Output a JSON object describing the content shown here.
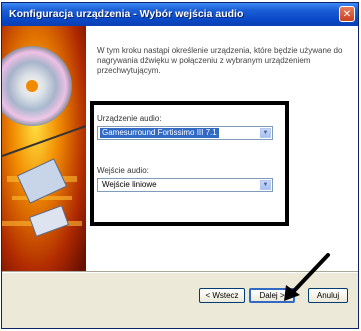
{
  "window": {
    "title": "Konfiguracja urządzenia - Wybór wejścia audio",
    "close_label": "✕"
  },
  "description": "W tym kroku nastąpi określenie urządzenia, które będzie używane do nagrywania dźwięku w połączeniu z wybranym urządzeniem przechwytującym.",
  "audio_device": {
    "label": "Urządzenie audio:",
    "value": "Gamesurround Fortissimo III 7.1"
  },
  "audio_input": {
    "label": "Wejście audio:",
    "value": "Wejście liniowe"
  },
  "buttons": {
    "back": "< Wstecz",
    "next": "Dalej >",
    "cancel": "Anuluj"
  },
  "icons": {
    "close": "close-icon",
    "dropdown": "chevron-down-icon",
    "pointer": "arrow-pointer-icon"
  }
}
